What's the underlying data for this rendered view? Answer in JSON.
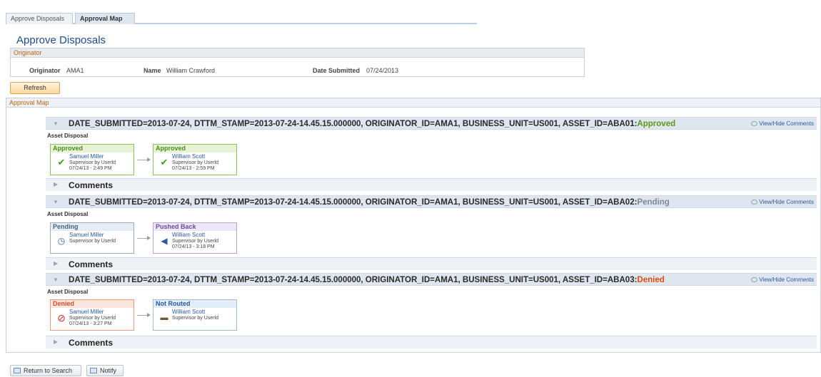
{
  "tabs": [
    {
      "label": "Approve Disposals"
    },
    {
      "label": "Approval Map"
    }
  ],
  "page_title": "Approve Disposals",
  "originator_section": {
    "header": "Originator",
    "originator_label": "Originator",
    "originator_value": "AMA1",
    "name_label": "Name",
    "name_value": "William Crawford",
    "date_label": "Date Submitted",
    "date_value": "07/24/2013"
  },
  "refresh_label": "Refresh",
  "approval_map": {
    "header": "Approval Map",
    "view_hide_label": "View/Hide Comments",
    "process_label": "Asset Disposal",
    "comments_label": "Comments",
    "rows": [
      {
        "prefix": "DATE_SUBMITTED=2013-07-24, DTTM_STAMP=2013-07-24-14.45.15.000000, ORIGINATOR_ID=AMA1, BUSINESS_UNIT=US001, ASSET_ID=ABA01:",
        "status": "Approved",
        "steps": [
          {
            "status": "Approved",
            "name": "Samuel Miller",
            "role": "Supervisor by Userld",
            "date": "07/24/13 - 2:49 PM"
          },
          {
            "status": "Approved",
            "name": "William Scott",
            "role": "Supervisor by Userld",
            "date": "07/24/13 - 2:59 PM"
          }
        ]
      },
      {
        "prefix": "DATE_SUBMITTED=2013-07-24, DTTM_STAMP=2013-07-24-14.45.15.000000, ORIGINATOR_ID=AMA1, BUSINESS_UNIT=US001, ASSET_ID=ABA02:",
        "status": "Pending",
        "steps": [
          {
            "status": "Pending",
            "name": "Samuel Miller",
            "role": "Supervisor by Userld",
            "date": ""
          },
          {
            "status": "Pushed Back",
            "name": "William Scott",
            "role": "Supervisor by Userld",
            "date": "07/24/13 - 3:18 PM"
          }
        ]
      },
      {
        "prefix": "DATE_SUBMITTED=2013-07-24, DTTM_STAMP=2013-07-24-14.45.15.000000, ORIGINATOR_ID=AMA1, BUSINESS_UNIT=US001, ASSET_ID=ABA03:",
        "status": "Denied",
        "steps": [
          {
            "status": "Denied",
            "name": "Samuel Miller",
            "role": "Supervisor by Userld",
            "date": "07/24/13 - 3:27 PM"
          },
          {
            "status": "Not Routed",
            "name": "William Scott",
            "role": "Supervisor by Userld",
            "date": ""
          }
        ]
      }
    ]
  },
  "footer": {
    "return_label": "Return to Search",
    "notify_label": "Notify"
  },
  "colors": {
    "approved": "#5c9b16",
    "pending": "#7b8a9a",
    "denied": "#e04d0f",
    "link": "#2a5a9c"
  }
}
